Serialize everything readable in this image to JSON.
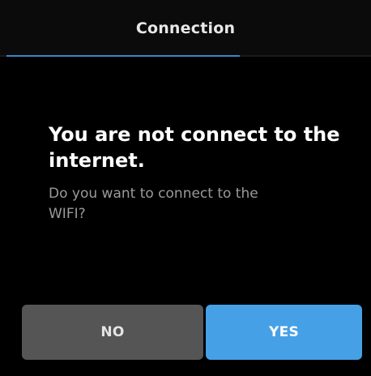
{
  "header": {
    "title": "Connection"
  },
  "dialog": {
    "heading": "You are not connect to the internet.",
    "message": "Do you want to connect to the WIFI?"
  },
  "buttons": {
    "no_label": "NO",
    "yes_label": "YES"
  },
  "colors": {
    "background": "#000000",
    "accent": "#46a0e6",
    "tab_indicator": "#3d86c7",
    "secondary_button": "#555555",
    "muted_text": "#9a9a9a"
  }
}
